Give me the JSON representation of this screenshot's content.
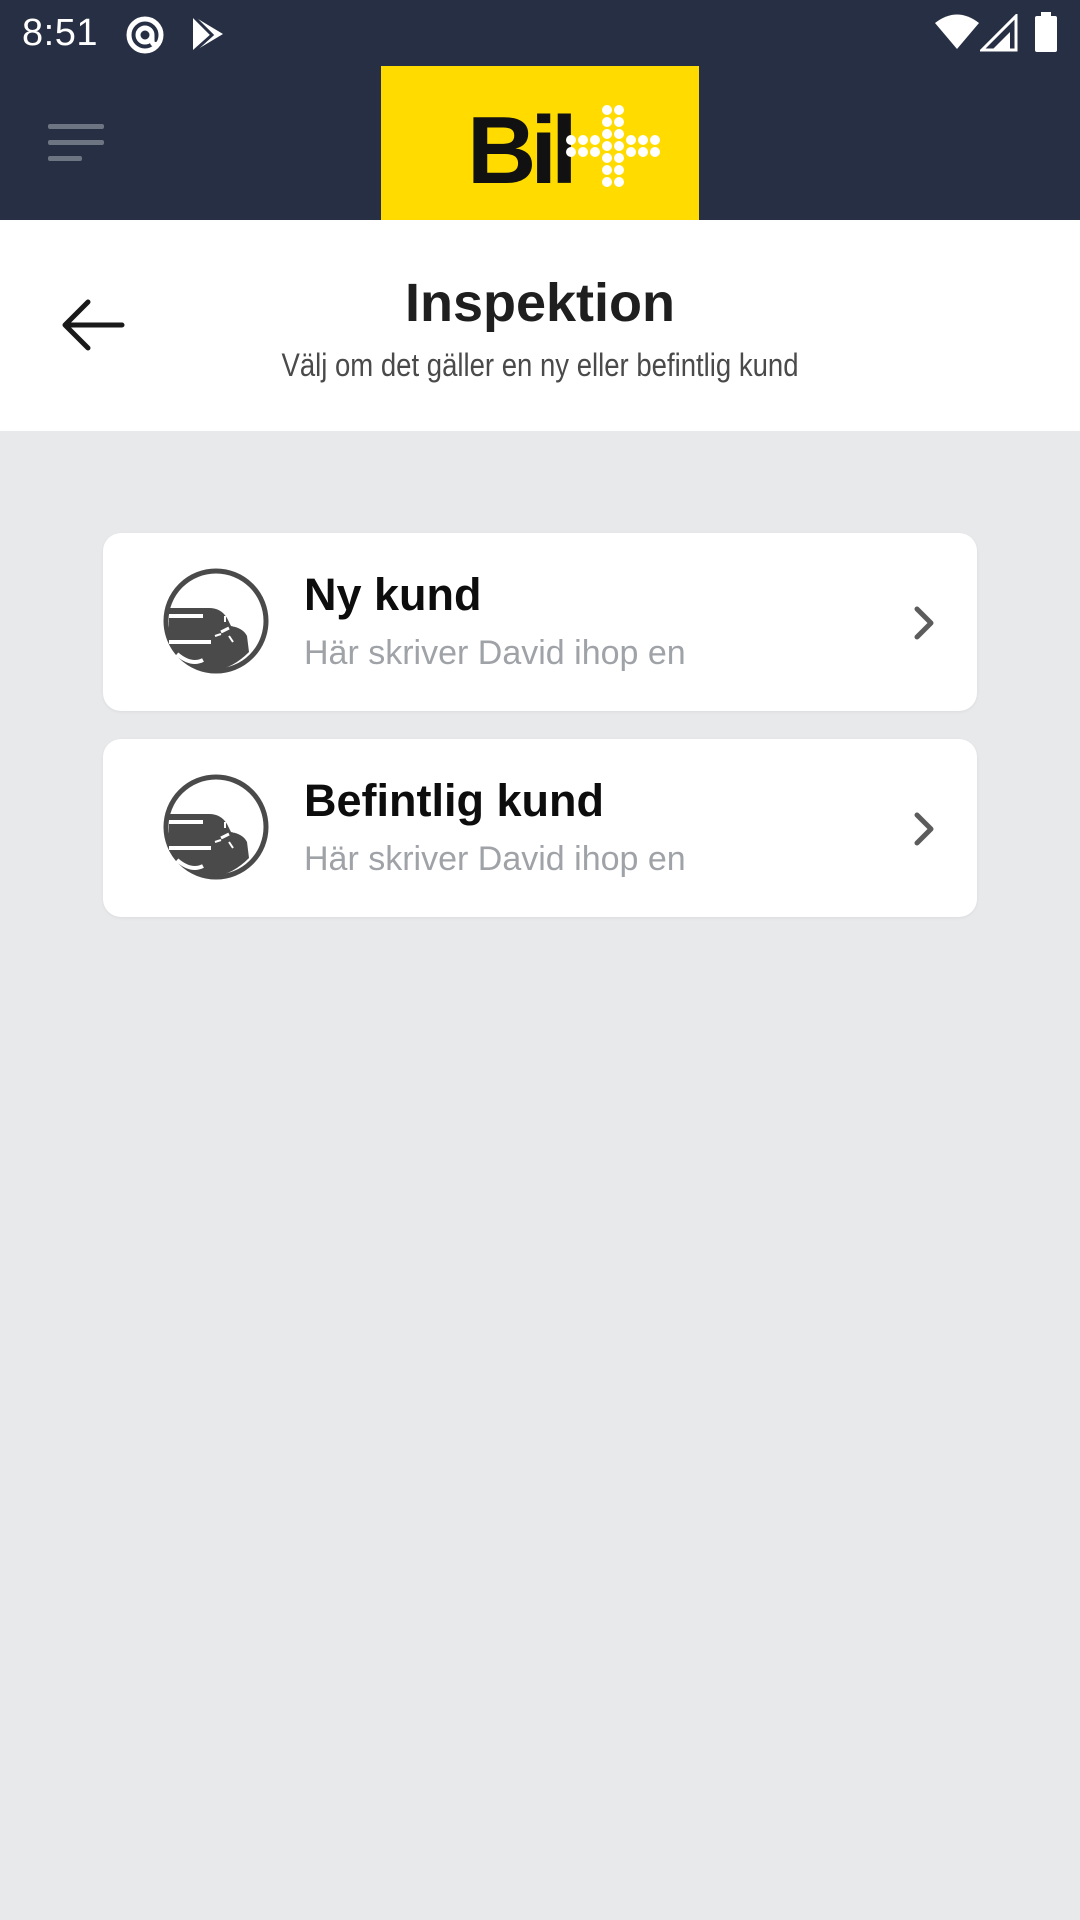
{
  "status_bar": {
    "time": "8:51",
    "icons": [
      "at-sign-icon",
      "play-store-icon",
      "wifi-icon",
      "cell-signal-icon",
      "battery-icon"
    ]
  },
  "header": {
    "menu_icon": "hamburger-menu-icon",
    "logo_text": "Bil",
    "logo_color": "#ffdb00",
    "background_color": "#262f43"
  },
  "page": {
    "back_icon": "arrow-left-icon",
    "title": "Inspektion",
    "subtitle": "Välj om det gäller en ny eller befintlig kund"
  },
  "options": [
    {
      "title": "Ny kund",
      "description": "Här skriver David ihop en",
      "icon": "car-icon"
    },
    {
      "title": "Befintlig kund",
      "description": "Här skriver David ihop en",
      "icon": "car-icon"
    }
  ],
  "colors": {
    "page_background": "#e8e9eb",
    "card_background": "#ffffff",
    "description_text": "#9fa2a7"
  }
}
